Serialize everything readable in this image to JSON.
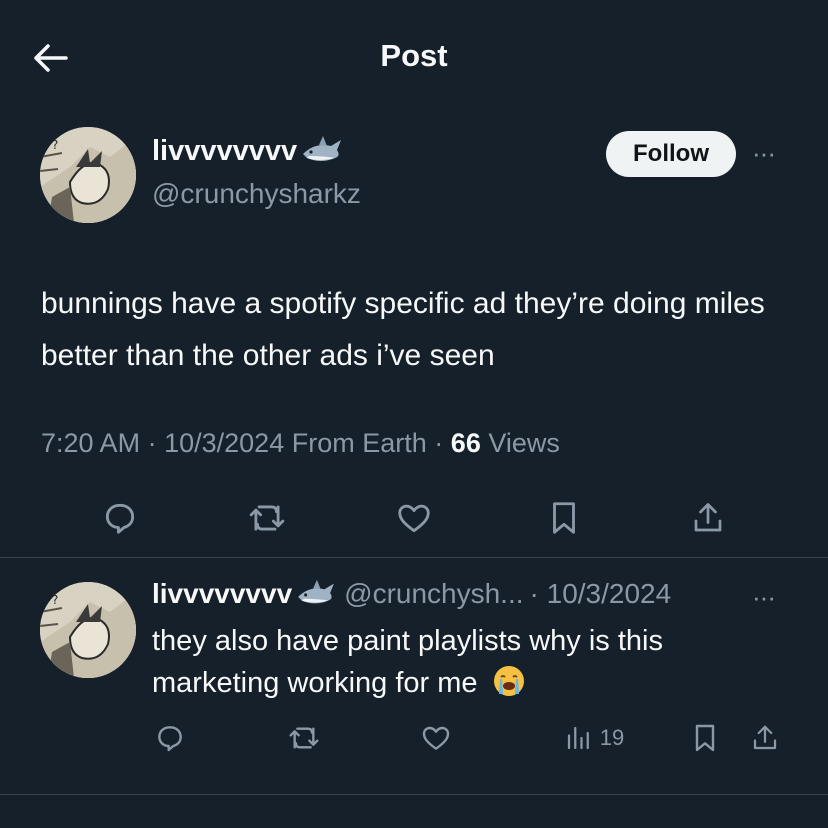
{
  "header": {
    "title": "Post",
    "back_icon": "arrow-left-icon"
  },
  "post": {
    "author_name": "livvvvvvvv",
    "author_emoji": "shark-emoji",
    "handle": "@crunchysharkz",
    "follow_label": "Follow",
    "more_label": "···",
    "text": "bunnings have a spotify specific ad they’re doing miles better than the other ads i’ve seen",
    "time": "7:20 AM",
    "date": "10/3/2024",
    "location": "From Earth",
    "views_count": "66",
    "views_label": "Views",
    "separator": "·"
  },
  "reply": {
    "author_name": "livvvvvvvv",
    "handle": "@crunchysh...",
    "date": "· 10/3/2024",
    "more_label": "···",
    "text": "they also have paint playlists why is this marketing working for me",
    "views_count": "19"
  },
  "colors": {
    "background": "#15202b",
    "text": "#f7f9f9",
    "muted": "#8b98a5",
    "divider": "#38444d",
    "follow_bg": "#eff3f4"
  }
}
